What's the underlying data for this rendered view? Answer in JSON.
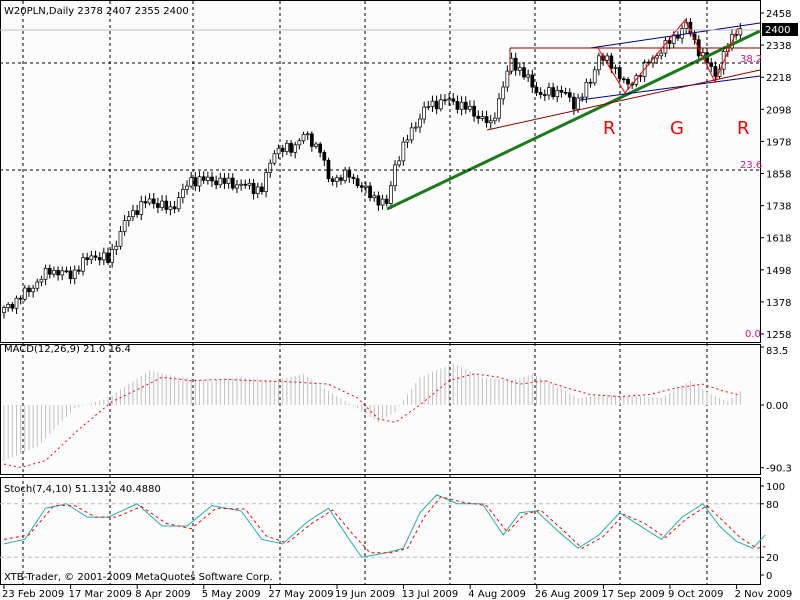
{
  "header": {
    "symbol_info": "W20PLN,Daily  2378 2407 2355 2400",
    "current_price": "2400"
  },
  "copyright": "XTB-Trader, © 2001-2009 MetaQuotes Software Corp.",
  "annotations": {
    "r1": "R",
    "g": "G",
    "r2": "R",
    "fib_382": "38.2",
    "fib_236": "23.6",
    "fib_0": "0.0"
  },
  "colors": {
    "bull": "#ffffff",
    "bear": "#000000",
    "trend": "#1a7a1a",
    "channel": "#00008b",
    "resist": "#8b0000",
    "fib": "#c71585",
    "macd_hist": "#c0c0c0",
    "signal": "#ff0000",
    "stoch_main": "#20b2aa",
    "label_red": "#ff0000"
  },
  "chart_data": [
    {
      "type": "candlestick",
      "title": "W20PLN,Daily",
      "ylim": [
        1258,
        2458
      ],
      "price_ticks": [
        "2458",
        "2338",
        "2218",
        "2098",
        "1978",
        "1858",
        "1738",
        "1618",
        "1498",
        "1378",
        "1258"
      ],
      "x_ticks": [
        "23 Feb 2009",
        "17 Mar 2009",
        "8 Apr 2009",
        "5 May 2009",
        "27 May 2009",
        "19 Jun 2009",
        "13 Jul 2009",
        "4 Aug 2009",
        "26 Aug 2009",
        "17 Sep 2009",
        "9 Oct 2009",
        "2 Nov 2009"
      ],
      "close_waypoints": [
        [
          0,
          1348
        ],
        [
          6,
          1422
        ],
        [
          11,
          1497
        ],
        [
          16,
          1478
        ],
        [
          21,
          1553
        ],
        [
          25,
          1535
        ],
        [
          30,
          1703
        ],
        [
          35,
          1759
        ],
        [
          40,
          1722
        ],
        [
          45,
          1834
        ],
        [
          50,
          1834
        ],
        [
          57,
          1815
        ],
        [
          62,
          1797
        ],
        [
          65,
          1946
        ],
        [
          69,
          1950
        ],
        [
          72,
          2002
        ],
        [
          76,
          1950
        ],
        [
          78,
          1834
        ],
        [
          83,
          1852
        ],
        [
          88,
          1778
        ],
        [
          92,
          1740
        ],
        [
          94,
          1890
        ],
        [
          98,
          2021
        ],
        [
          102,
          2114
        ],
        [
          107,
          2133
        ],
        [
          112,
          2095
        ],
        [
          117,
          2039
        ],
        [
          119,
          2133
        ],
        [
          122,
          2282
        ],
        [
          124,
          2245
        ],
        [
          129,
          2151
        ],
        [
          134,
          2170
        ],
        [
          137,
          2114
        ],
        [
          141,
          2200
        ],
        [
          143,
          2301
        ],
        [
          147,
          2250
        ],
        [
          150,
          2180
        ],
        [
          153,
          2240
        ],
        [
          158,
          2320
        ],
        [
          164,
          2413
        ],
        [
          167,
          2320
        ],
        [
          171,
          2226
        ],
        [
          173,
          2300
        ],
        [
          176,
          2394
        ],
        [
          177,
          2400
        ]
      ]
    },
    {
      "type": "bar",
      "title": "MACD(12,26,9) 21.0 16.4",
      "ylim": [
        -90.3,
        83.5
      ],
      "ticks": [
        "83.5",
        "0.00",
        "-90.3"
      ],
      "hist_waypoints": [
        [
          0,
          -80
        ],
        [
          8,
          -60
        ],
        [
          17,
          -5
        ],
        [
          25,
          10
        ],
        [
          35,
          50
        ],
        [
          42,
          40
        ],
        [
          50,
          35
        ],
        [
          57,
          40
        ],
        [
          65,
          35
        ],
        [
          72,
          45
        ],
        [
          78,
          20
        ],
        [
          85,
          -5
        ],
        [
          90,
          -25
        ],
        [
          94,
          -10
        ],
        [
          100,
          40
        ],
        [
          108,
          60
        ],
        [
          115,
          40
        ],
        [
          122,
          35
        ],
        [
          127,
          45
        ],
        [
          132,
          30
        ],
        [
          138,
          10
        ],
        [
          145,
          15
        ],
        [
          152,
          12
        ],
        [
          158,
          10
        ],
        [
          165,
          35
        ],
        [
          170,
          15
        ],
        [
          174,
          5
        ],
        [
          177,
          20
        ]
      ],
      "signal_waypoints": [
        [
          0,
          -85
        ],
        [
          4,
          -90
        ],
        [
          10,
          -80
        ],
        [
          18,
          -35
        ],
        [
          26,
          5
        ],
        [
          33,
          25
        ],
        [
          38,
          40
        ],
        [
          45,
          35
        ],
        [
          53,
          37
        ],
        [
          60,
          35
        ],
        [
          70,
          33
        ],
        [
          78,
          30
        ],
        [
          85,
          10
        ],
        [
          90,
          -20
        ],
        [
          94,
          -25
        ],
        [
          100,
          0
        ],
        [
          107,
          35
        ],
        [
          113,
          45
        ],
        [
          119,
          40
        ],
        [
          124,
          30
        ],
        [
          130,
          35
        ],
        [
          135,
          25
        ],
        [
          141,
          15
        ],
        [
          148,
          12
        ],
        [
          155,
          15
        ],
        [
          162,
          25
        ],
        [
          168,
          30
        ],
        [
          173,
          20
        ],
        [
          177,
          14
        ]
      ]
    },
    {
      "type": "line",
      "title": "Stoch(7,4,10) 51.1312 40.4880",
      "ylim": [
        0,
        100
      ],
      "ticks": [
        "100",
        "80",
        "20",
        "0"
      ],
      "main_waypoints": [
        [
          0,
          35
        ],
        [
          5,
          40
        ],
        [
          10,
          75
        ],
        [
          15,
          80
        ],
        [
          20,
          65
        ],
        [
          25,
          65
        ],
        [
          32,
          80
        ],
        [
          38,
          55
        ],
        [
          44,
          55
        ],
        [
          50,
          78
        ],
        [
          57,
          72
        ],
        [
          62,
          40
        ],
        [
          67,
          35
        ],
        [
          73,
          60
        ],
        [
          78,
          75
        ],
        [
          83,
          40
        ],
        [
          86,
          20
        ],
        [
          92,
          25
        ],
        [
          96,
          30
        ],
        [
          100,
          70
        ],
        [
          104,
          90
        ],
        [
          109,
          80
        ],
        [
          115,
          80
        ],
        [
          120,
          45
        ],
        [
          124,
          70
        ],
        [
          128,
          72
        ],
        [
          133,
          50
        ],
        [
          138,
          30
        ],
        [
          143,
          45
        ],
        [
          148,
          70
        ],
        [
          153,
          55
        ],
        [
          158,
          40
        ],
        [
          163,
          65
        ],
        [
          168,
          80
        ],
        [
          172,
          55
        ],
        [
          176,
          38
        ],
        [
          180,
          30
        ],
        [
          183,
          45
        ]
      ],
      "signal_waypoints": [
        [
          0,
          40
        ],
        [
          6,
          45
        ],
        [
          12,
          78
        ],
        [
          17,
          78
        ],
        [
          22,
          65
        ],
        [
          27,
          65
        ],
        [
          33,
          77
        ],
        [
          39,
          58
        ],
        [
          45,
          52
        ],
        [
          51,
          75
        ],
        [
          58,
          74
        ],
        [
          63,
          44
        ],
        [
          68,
          36
        ],
        [
          74,
          58
        ],
        [
          79,
          73
        ],
        [
          84,
          45
        ],
        [
          88,
          25
        ],
        [
          93,
          25
        ],
        [
          97,
          30
        ],
        [
          101,
          65
        ],
        [
          105,
          88
        ],
        [
          110,
          82
        ],
        [
          116,
          78
        ],
        [
          121,
          48
        ],
        [
          125,
          68
        ],
        [
          129,
          73
        ],
        [
          134,
          52
        ],
        [
          139,
          30
        ],
        [
          144,
          43
        ],
        [
          149,
          68
        ],
        [
          154,
          58
        ],
        [
          159,
          42
        ],
        [
          164,
          63
        ],
        [
          169,
          78
        ],
        [
          173,
          60
        ],
        [
          177,
          42
        ],
        [
          181,
          30
        ],
        [
          183,
          32
        ]
      ]
    }
  ]
}
